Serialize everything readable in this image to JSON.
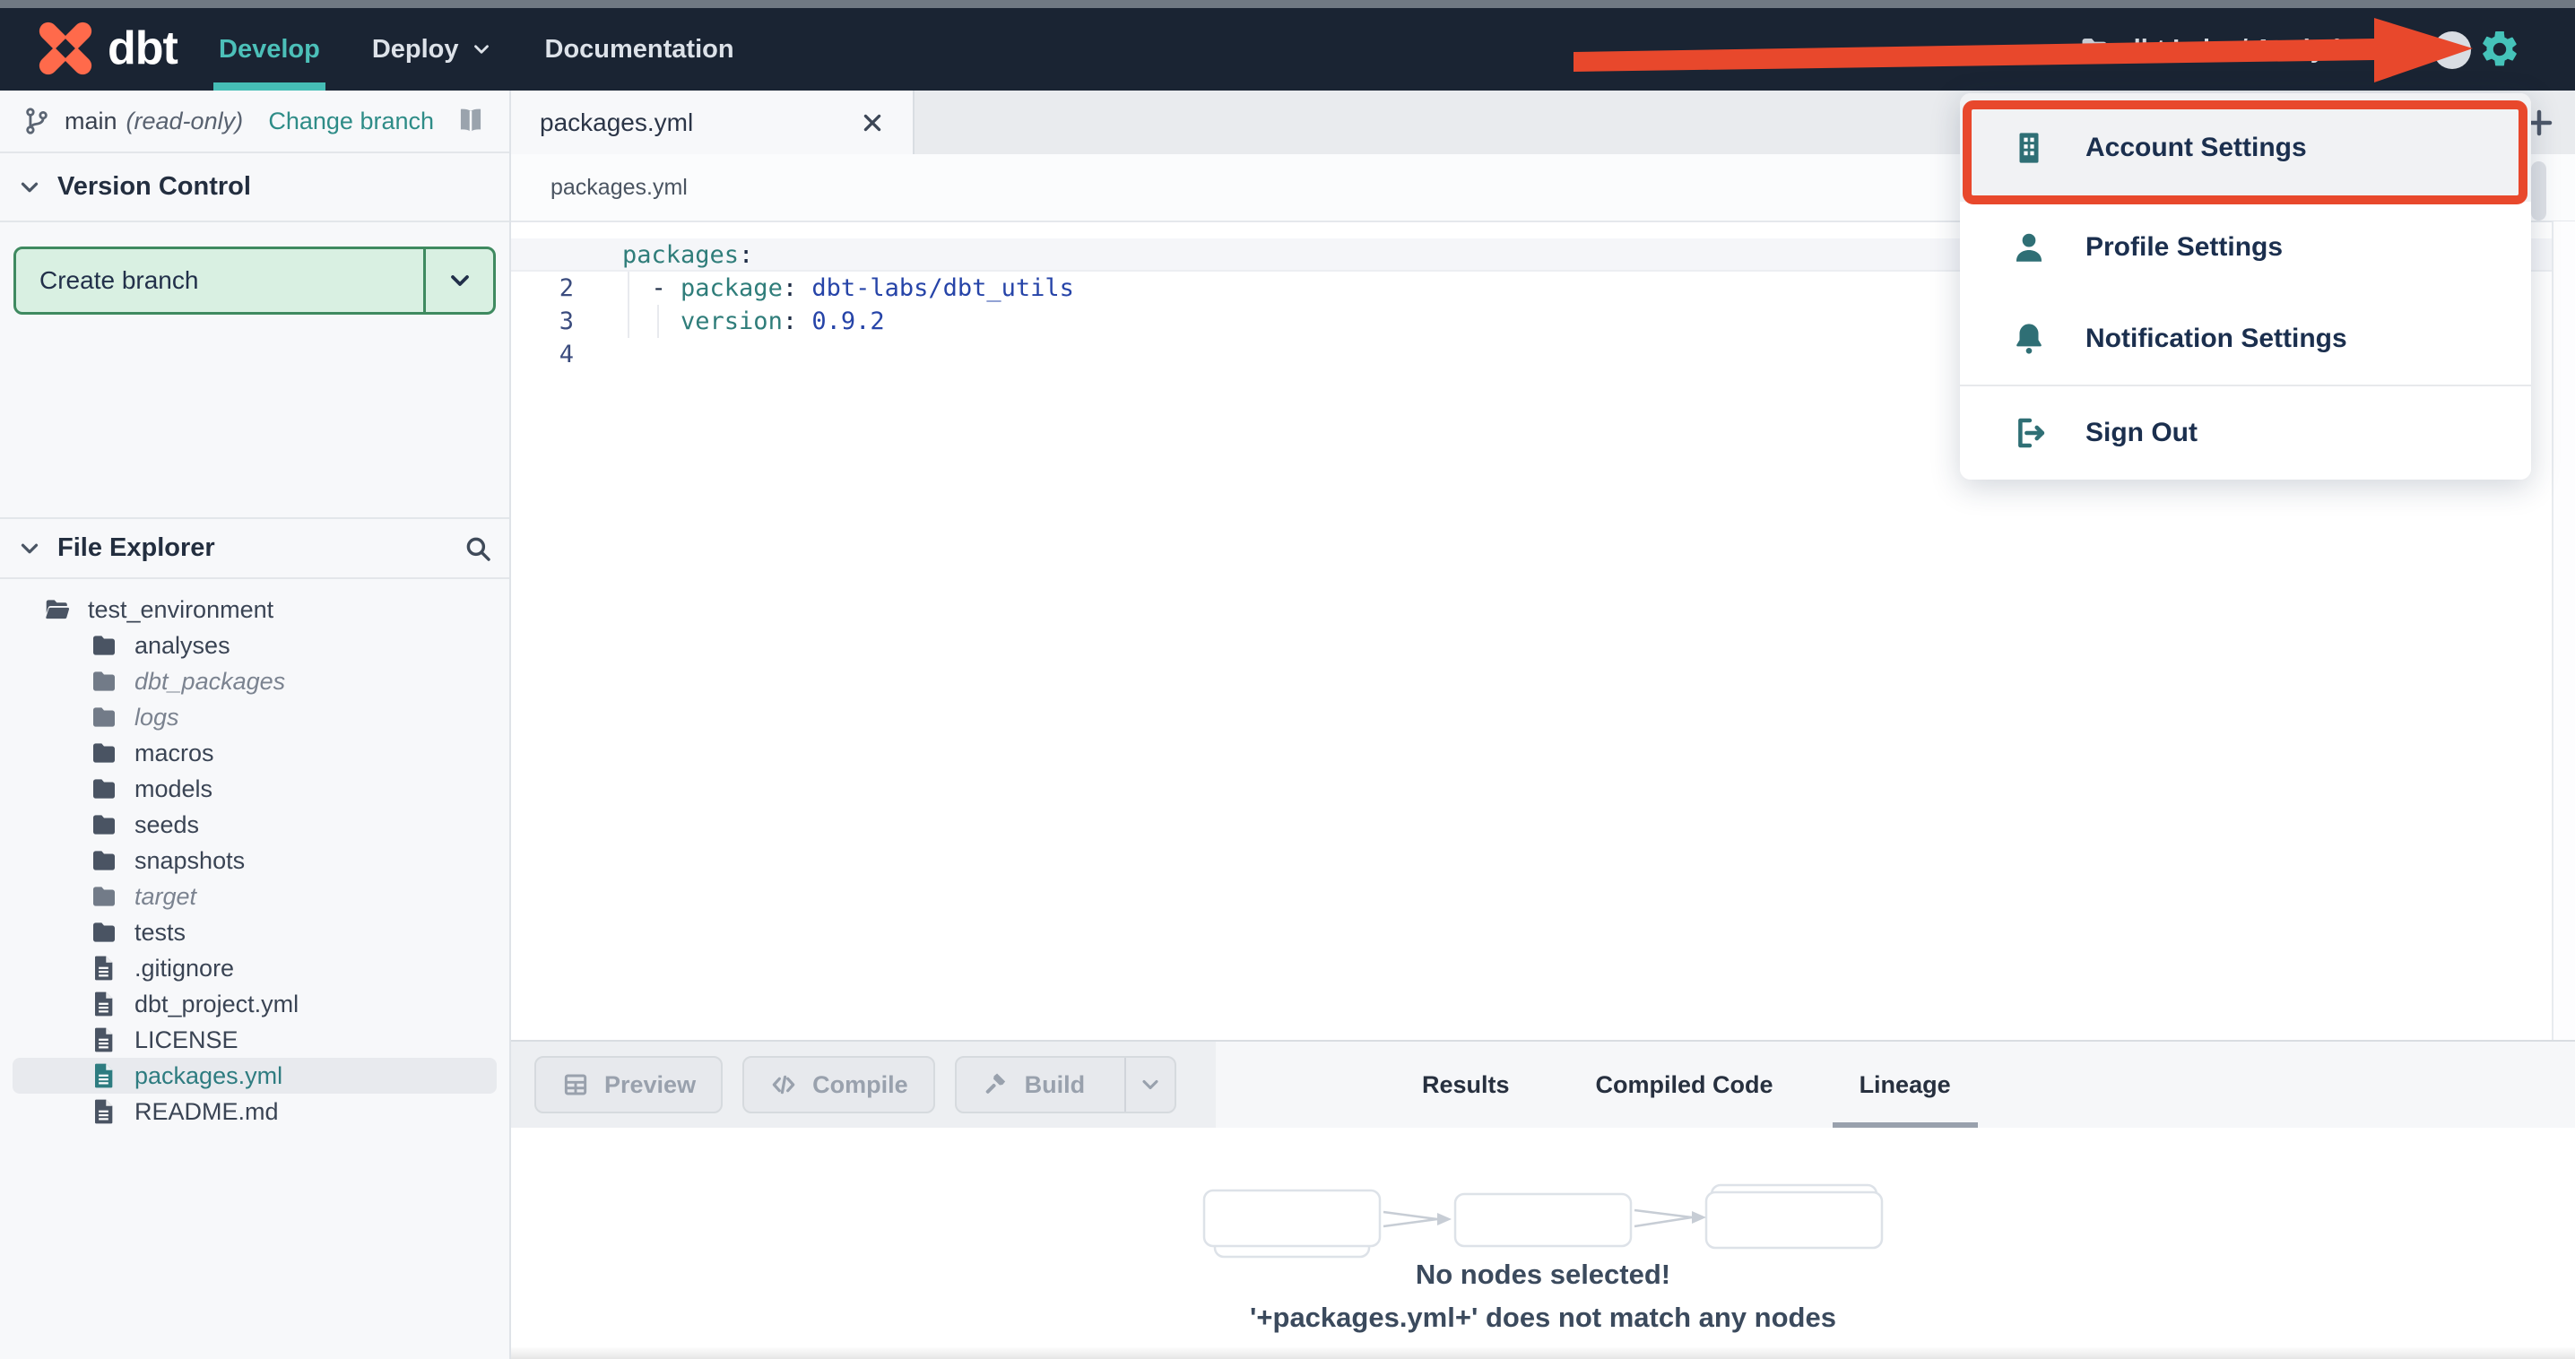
{
  "colors": {
    "navbar_bg": "#1a2433",
    "nav_accent_teal": "#45bdb5",
    "menu_icon_teal": "#2f6f75",
    "annotation_red": "#e8482c",
    "create_branch_green_bg": "#d9f0e2",
    "create_branch_green_border": "#3f8a60",
    "selected_file_teal": "#2e7c80",
    "code_key_teal": "#2f7d7a",
    "code_value_blue": "#2644a8"
  },
  "navbar": {
    "logo_text": "dbt",
    "items": [
      {
        "label": "Develop",
        "active": true,
        "chevron": false
      },
      {
        "label": "Deploy",
        "active": false,
        "chevron": true
      },
      {
        "label": "Documentation",
        "active": false,
        "chevron": false
      }
    ],
    "account_label": "dbt Labs / Analytics"
  },
  "menu": {
    "items": [
      {
        "label": "Account Settings",
        "icon": "building",
        "highlighted": true
      },
      {
        "label": "Profile Settings",
        "icon": "user",
        "highlighted": false
      },
      {
        "label": "Notification Settings",
        "icon": "bell",
        "highlighted": false
      },
      {
        "label": "Sign Out",
        "icon": "signout",
        "highlighted": false,
        "divided": true
      }
    ]
  },
  "version_control": {
    "branch_name": "main",
    "read_only_label": "(read-only)",
    "change_branch_label": "Change branch",
    "section_title": "Version Control",
    "create_branch_label": "Create branch"
  },
  "file_explorer": {
    "section_title": "File Explorer",
    "files": [
      {
        "name": "test_environment",
        "type": "folder-open",
        "depth": 0,
        "muted": false,
        "selected": false
      },
      {
        "name": "analyses",
        "type": "folder",
        "depth": 1,
        "muted": false,
        "selected": false
      },
      {
        "name": "dbt_packages",
        "type": "folder",
        "depth": 1,
        "muted": true,
        "selected": false
      },
      {
        "name": "logs",
        "type": "folder",
        "depth": 1,
        "muted": true,
        "selected": false
      },
      {
        "name": "macros",
        "type": "folder",
        "depth": 1,
        "muted": false,
        "selected": false
      },
      {
        "name": "models",
        "type": "folder",
        "depth": 1,
        "muted": false,
        "selected": false
      },
      {
        "name": "seeds",
        "type": "folder",
        "depth": 1,
        "muted": false,
        "selected": false
      },
      {
        "name": "snapshots",
        "type": "folder",
        "depth": 1,
        "muted": false,
        "selected": false
      },
      {
        "name": "target",
        "type": "folder",
        "depth": 1,
        "muted": true,
        "selected": false
      },
      {
        "name": "tests",
        "type": "folder",
        "depth": 1,
        "muted": false,
        "selected": false
      },
      {
        "name": ".gitignore",
        "type": "file",
        "depth": 1,
        "muted": false,
        "selected": false
      },
      {
        "name": "dbt_project.yml",
        "type": "file",
        "depth": 1,
        "muted": false,
        "selected": false
      },
      {
        "name": "LICENSE",
        "type": "file",
        "depth": 1,
        "muted": false,
        "selected": false
      },
      {
        "name": "packages.yml",
        "type": "file",
        "depth": 1,
        "muted": false,
        "selected": true
      },
      {
        "name": "README.md",
        "type": "file",
        "depth": 1,
        "muted": false,
        "selected": false
      }
    ]
  },
  "editor": {
    "tab_label": "packages.yml",
    "breadcrumb": "packages.yml",
    "code_lines": [
      [
        {
          "t": "packages",
          "c": "k"
        },
        {
          "t": ":",
          "c": "p"
        }
      ],
      [
        {
          "t": "  - ",
          "c": "p"
        },
        {
          "t": "package",
          "c": "k"
        },
        {
          "t": ": ",
          "c": "p"
        },
        {
          "t": "dbt-labs/dbt_utils",
          "c": "v"
        }
      ],
      [
        {
          "t": "    ",
          "c": "p"
        },
        {
          "t": "version",
          "c": "k"
        },
        {
          "t": ": ",
          "c": "p"
        },
        {
          "t": "0.9.2",
          "c": "v"
        }
      ],
      []
    ]
  },
  "toolbar": {
    "buttons": [
      {
        "label": "Preview",
        "icon": "grid",
        "split": false
      },
      {
        "label": "Compile",
        "icon": "code",
        "split": false
      },
      {
        "label": "Build",
        "icon": "hammer",
        "split": true
      }
    ],
    "tabs": [
      {
        "label": "Results",
        "active": false
      },
      {
        "label": "Compiled Code",
        "active": false
      },
      {
        "label": "Lineage",
        "active": true
      }
    ]
  },
  "lineage": {
    "message_line1": "No nodes selected!",
    "message_line2": "'+packages.yml+' does not match any nodes"
  }
}
